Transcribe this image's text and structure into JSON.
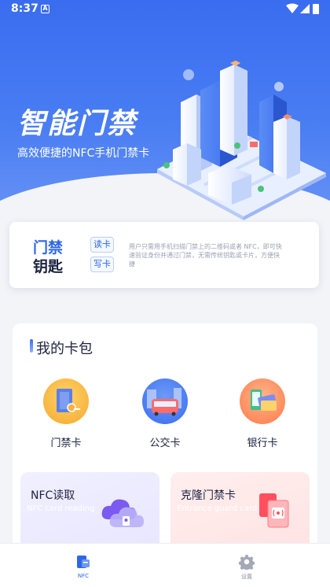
{
  "status_bar": {
    "time": "8:37",
    "notification_letter": "A"
  },
  "hero": {
    "title": "智能门禁",
    "subtitle": "高效便捷的NFC手机门禁卡"
  },
  "key_card": {
    "title_line1": "门禁",
    "title_line2": "钥匙",
    "read_label": "读卡",
    "write_label": "写卡",
    "description": "用户只需用手机扫描门禁上的二维码或者 NFC，即可快速验证身份并通过门禁，无需传统钥匙或卡片，方便快捷"
  },
  "wallet": {
    "title": "我的卡包",
    "items": [
      {
        "label": "门禁卡",
        "icon": "access-card-icon"
      },
      {
        "label": "公交卡",
        "icon": "bus-card-icon"
      },
      {
        "label": "银行卡",
        "icon": "bank-card-icon"
      }
    ]
  },
  "features": [
    {
      "title": "NFC读取",
      "subtitle": "NFC card reading",
      "icon": "nfc-cloud-icon"
    },
    {
      "title": "克隆门禁卡",
      "subtitle": "Entrance guard card",
      "icon": "clone-card-icon"
    }
  ],
  "bottom_nav": [
    {
      "label": "NFC",
      "icon": "nfc-card-icon",
      "active": true
    },
    {
      "label": "设置",
      "icon": "gear-icon",
      "active": false
    }
  ],
  "colors": {
    "primary": "#2f66e8",
    "hero_gradient_top": "#3a6cf0",
    "nfc_feature_bg": "#eeedff",
    "clone_feature_bg": "#ffe9e9"
  }
}
